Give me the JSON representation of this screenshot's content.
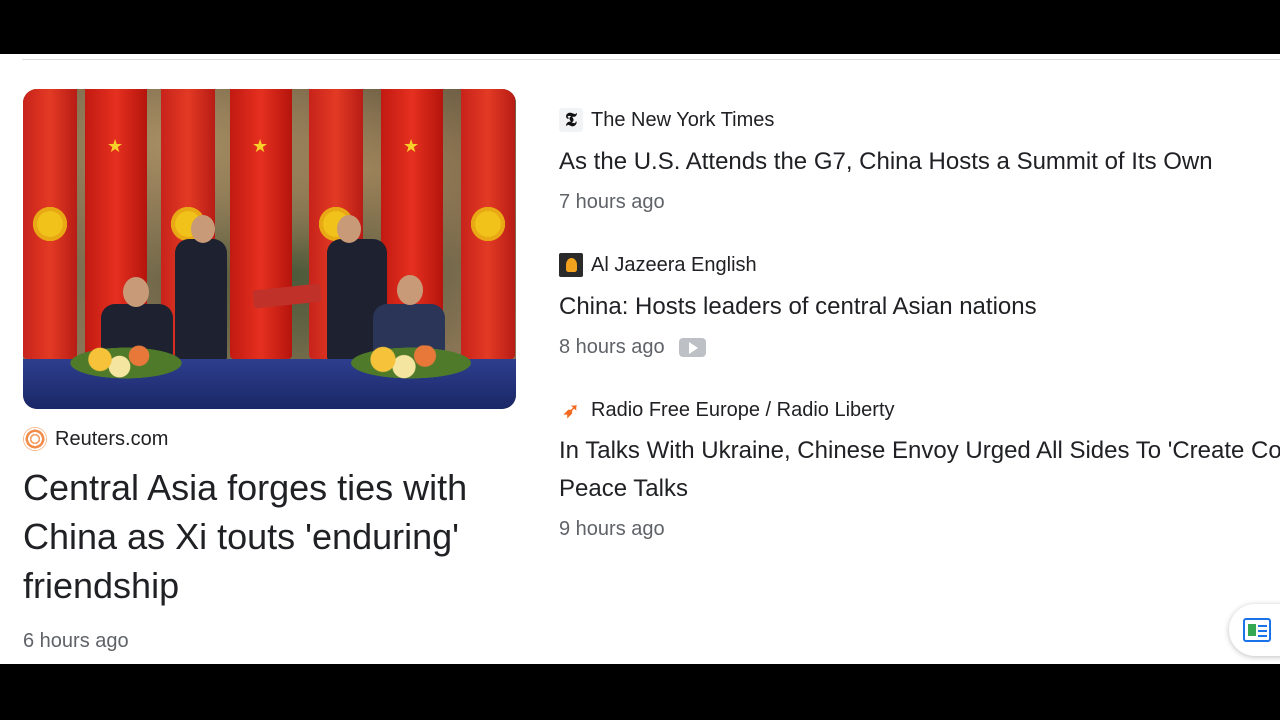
{
  "featured": {
    "source": "Reuters.com",
    "title": "Central Asia forges ties with China as Xi touts 'enduring' friendship",
    "time": "6 hours ago",
    "image_alt": "Leaders at a signing ceremony in front of Kyrgyz and Chinese flags"
  },
  "stories": [
    {
      "source": "The New York Times",
      "logo": "nyt-logo",
      "title": "As the U.S. Attends the G7, China Hosts a Summit of Its Own",
      "time": "7 hours ago",
      "video": false
    },
    {
      "source": "Al Jazeera English",
      "logo": "aljazeera-logo",
      "title": "China: Hosts leaders of central Asian nations",
      "time": "8 hours ago",
      "video": true
    },
    {
      "source": "Radio Free Europe / Radio Liberty",
      "logo": "rferl-logo",
      "title": "In Talks With Ukraine, Chinese Envoy Urged All Sides To 'Create Co",
      "title_line2": "Peace Talks",
      "time": "9 hours ago",
      "video": false
    }
  ],
  "fab": {
    "icon": "news-feed-icon"
  }
}
